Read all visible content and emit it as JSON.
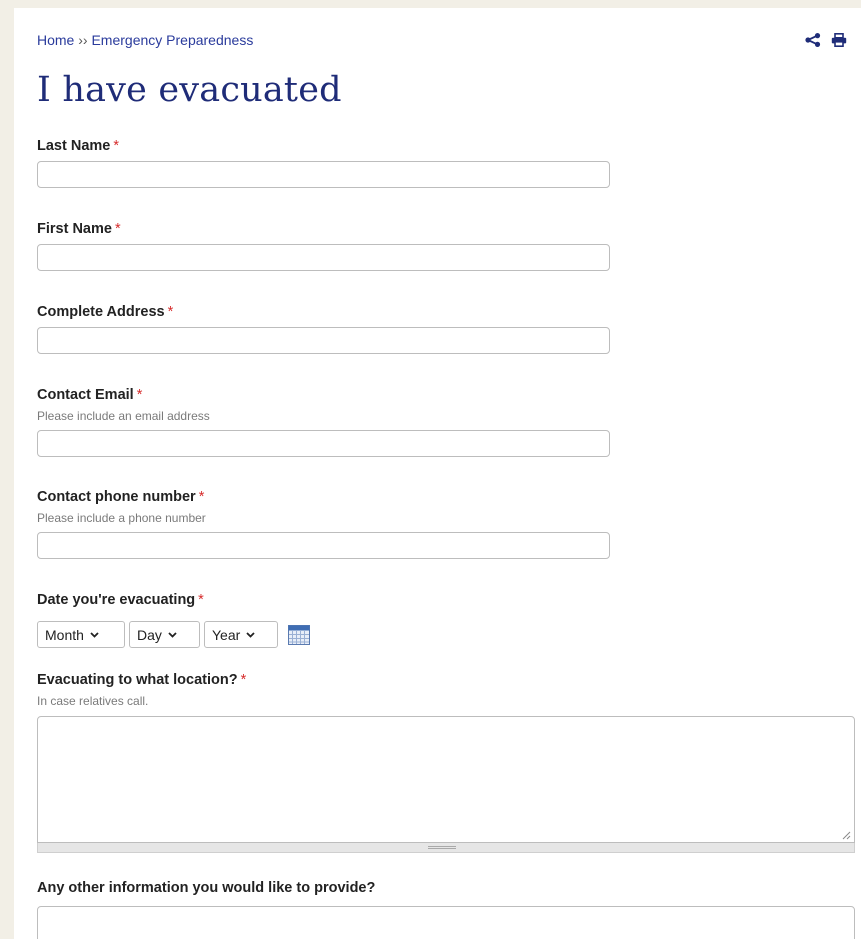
{
  "breadcrumb": {
    "home": "Home",
    "separator": "››",
    "current": "Emergency Preparedness"
  },
  "toolbar": {
    "share_icon": "share-icon",
    "print_icon": "print-icon"
  },
  "page_title": "I have evacuated",
  "required_marker": "*",
  "fields": {
    "last_name": {
      "label": "Last Name",
      "value": "",
      "placeholder": ""
    },
    "first_name": {
      "label": "First Name",
      "value": "",
      "placeholder": ""
    },
    "address": {
      "label": "Complete Address",
      "value": "",
      "placeholder": ""
    },
    "email": {
      "label": "Contact Email",
      "help": "Please include an email address",
      "value": ""
    },
    "phone": {
      "label": "Contact phone number",
      "help": "Please include a phone number",
      "value": ""
    },
    "date": {
      "label": "Date you're evacuating",
      "month": "Month",
      "day": "Day",
      "year": "Year",
      "calendar_icon": "calendar-icon"
    },
    "location": {
      "label": "Evacuating to what location?",
      "help": "In case relatives call.",
      "value": ""
    },
    "other_info": {
      "label": "Any other information you would like to provide?",
      "value": ""
    }
  },
  "colors": {
    "background": "#f2efe6",
    "link": "#2a3b9c",
    "title": "#1f2c78",
    "required": "#d62b2b"
  }
}
